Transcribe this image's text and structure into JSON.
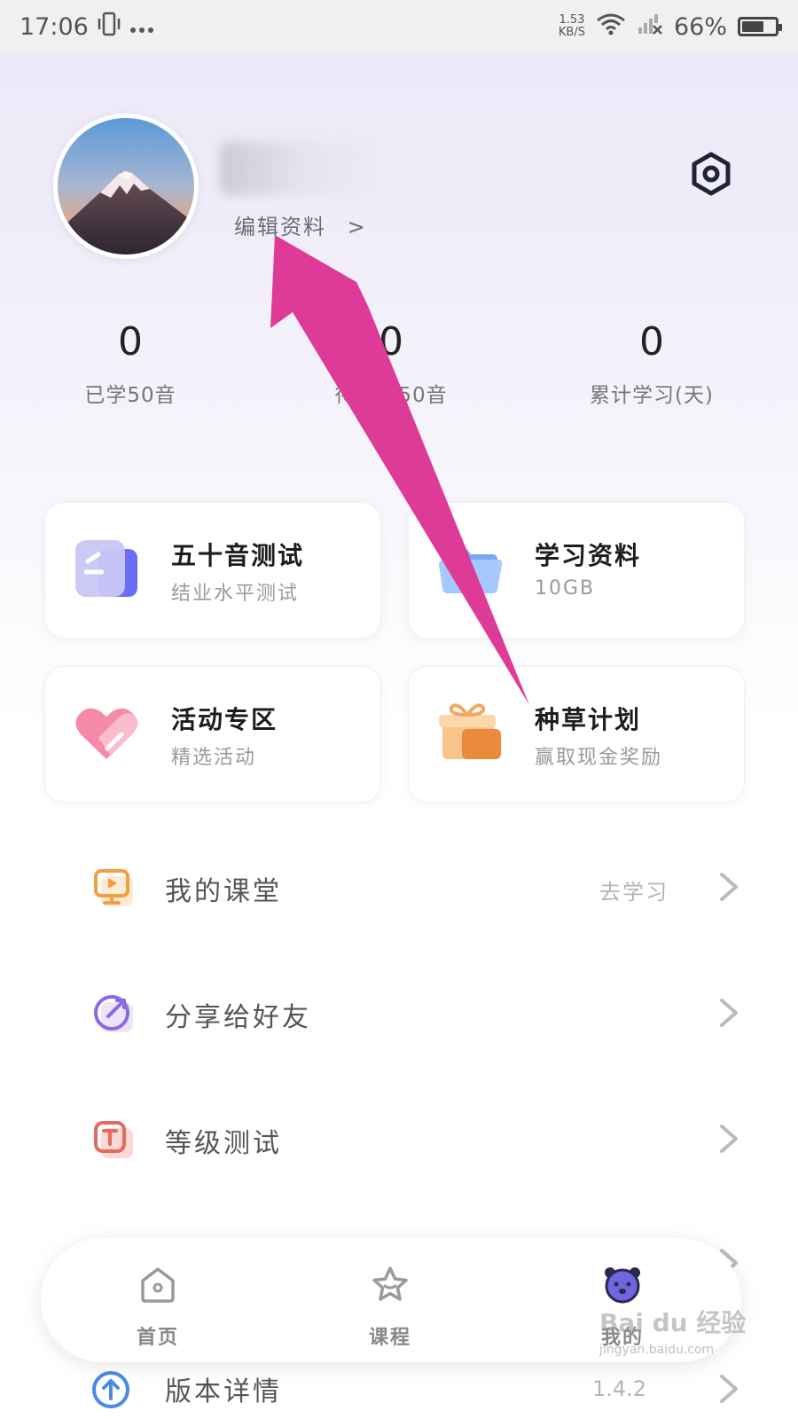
{
  "status_bar": {
    "time": "17:06",
    "net_speed_value": "1.53",
    "net_speed_unit": "KB/S",
    "battery": "66%",
    "battery_level": 0.66,
    "icons": [
      "vibrate-icon",
      "more-dots-icon",
      "wifi-icon",
      "signal-off-icon",
      "battery-icon"
    ]
  },
  "profile": {
    "edit_label": "编辑资料",
    "edit_chevron": ">",
    "settings_icon": "settings-hex-icon"
  },
  "stats": [
    {
      "value": "0",
      "label": "已学50音"
    },
    {
      "value": "0",
      "label": "待复习50音"
    },
    {
      "value": "0",
      "label": "累计学习(天)"
    }
  ],
  "cards": [
    {
      "title": "五十音测试",
      "subtitle": "结业水平测试",
      "icon": "test-document-icon"
    },
    {
      "title": "学习资料",
      "subtitle": "10GB",
      "icon": "folder-icon"
    },
    {
      "title": "活动专区",
      "subtitle": "精选活动",
      "icon": "heart-icon"
    },
    {
      "title": "种草计划",
      "subtitle": "赢取现金奖励",
      "icon": "gift-icon"
    }
  ],
  "menu": [
    {
      "label": "我的课堂",
      "value": "去学习",
      "icon": "classroom-icon"
    },
    {
      "label": "分享给好友",
      "value": "",
      "icon": "share-icon"
    },
    {
      "label": "等级测试",
      "value": "",
      "icon": "level-test-icon"
    }
  ],
  "hidden_row": {
    "label": "版本详情",
    "value": "1.4.2"
  },
  "bottom_nav": [
    {
      "label": "首页",
      "icon": "home-icon"
    },
    {
      "label": "课程",
      "icon": "course-star-icon"
    },
    {
      "label": "我的",
      "icon": "bear-avatar-icon"
    }
  ],
  "watermark": {
    "text": "Bai du 经验",
    "url": "jingyan.baidu.com"
  },
  "colors": {
    "annotation_arrow": "#de3a97",
    "accent_purple": "#6f66e0",
    "accent_orange": "#f0a040"
  }
}
